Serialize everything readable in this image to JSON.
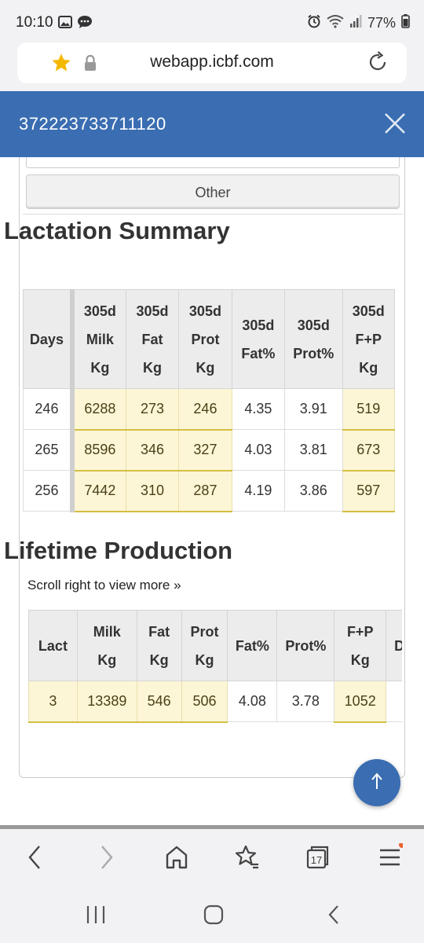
{
  "status_bar": {
    "time": "10:10",
    "battery": "77%",
    "icons": [
      "gallery-icon",
      "chat-icon",
      "alarm-icon",
      "wifi-icon",
      "signal-icon",
      "battery-icon"
    ]
  },
  "browser": {
    "url": "webapp.icbf.com"
  },
  "modal": {
    "title": "372223733711120"
  },
  "content": {
    "other_button": "Other",
    "lactation_title": "Lactation Summary",
    "lactation_table": {
      "headers": [
        [
          "Days"
        ],
        [
          "305d",
          "Milk",
          "Kg"
        ],
        [
          "305d",
          "Fat",
          "Kg"
        ],
        [
          "305d",
          "Prot",
          "Kg"
        ],
        [
          "305d",
          "Fat%"
        ],
        [
          "305d",
          "Prot%"
        ],
        [
          "305d",
          "F+P",
          "Kg"
        ]
      ],
      "rows": [
        [
          "246",
          "6288",
          "273",
          "246",
          "4.35",
          "3.91",
          "519"
        ],
        [
          "265",
          "8596",
          "346",
          "327",
          "4.03",
          "3.81",
          "673"
        ],
        [
          "256",
          "7442",
          "310",
          "287",
          "4.19",
          "3.86",
          "597"
        ]
      ]
    },
    "lifetime_title": "Lifetime Production",
    "scroll_hint": "Scroll right to view more »",
    "lifetime_table": {
      "headers": [
        [
          "Lact"
        ],
        [
          "Milk",
          "Kg"
        ],
        [
          "Fat",
          "Kg"
        ],
        [
          "Prot",
          "Kg"
        ],
        [
          "Fat%"
        ],
        [
          "Prot%"
        ],
        [
          "F+P",
          "Kg"
        ],
        [
          "D"
        ]
      ],
      "rows": [
        [
          "3",
          "13389",
          "546",
          "506",
          "4.08",
          "3.78",
          "1052",
          ""
        ]
      ]
    }
  },
  "toolbar": {
    "tabs_count": "17"
  },
  "colors": {
    "header_blue": "#3a6db1",
    "highlight_yellow": "#fcf6d6",
    "star_yellow": "#f5b800"
  }
}
